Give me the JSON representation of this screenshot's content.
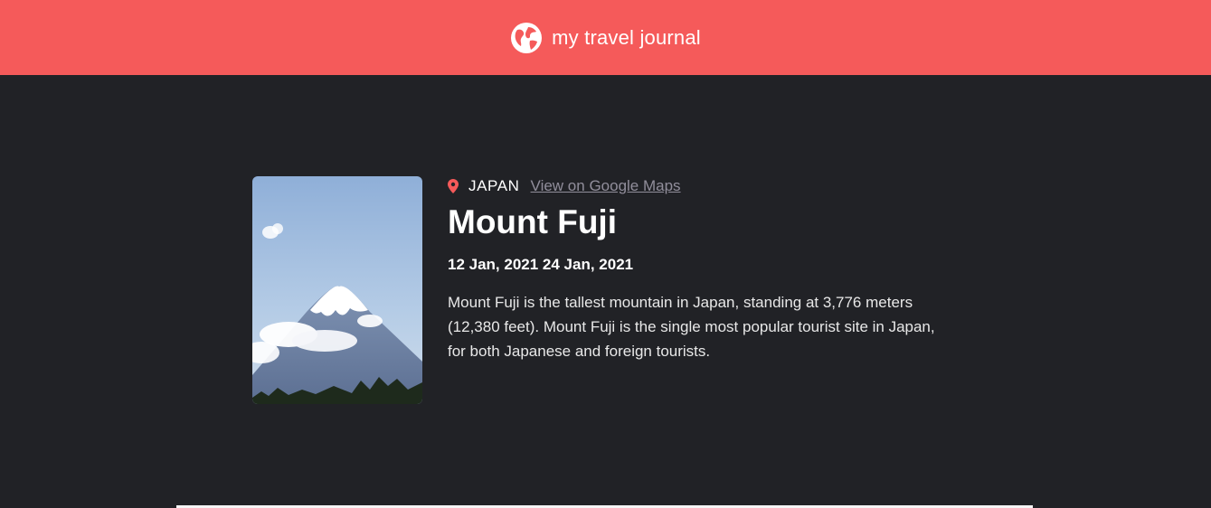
{
  "header": {
    "brand": "my travel journal",
    "icon": "globe-icon",
    "background": "#F55A5A"
  },
  "entry": {
    "location": "JAPAN",
    "location_icon": "map-pin-icon",
    "maps_link_label": "View on Google Maps",
    "title": "Mount Fuji",
    "dates": "12 Jan, 2021 24 Jan, 2021",
    "description": "Mount Fuji is the tallest mountain in Japan, standing at 3,776 meters (12,380 feet). Mount Fuji is the single most popular tourist site in Japan, for both Japanese and foreign tourists.",
    "image": "mount-fuji-photo"
  },
  "colors": {
    "page_background": "#212226",
    "accent": "#F55A5A",
    "link": "#918E9B",
    "text": "#FFFFFF"
  }
}
